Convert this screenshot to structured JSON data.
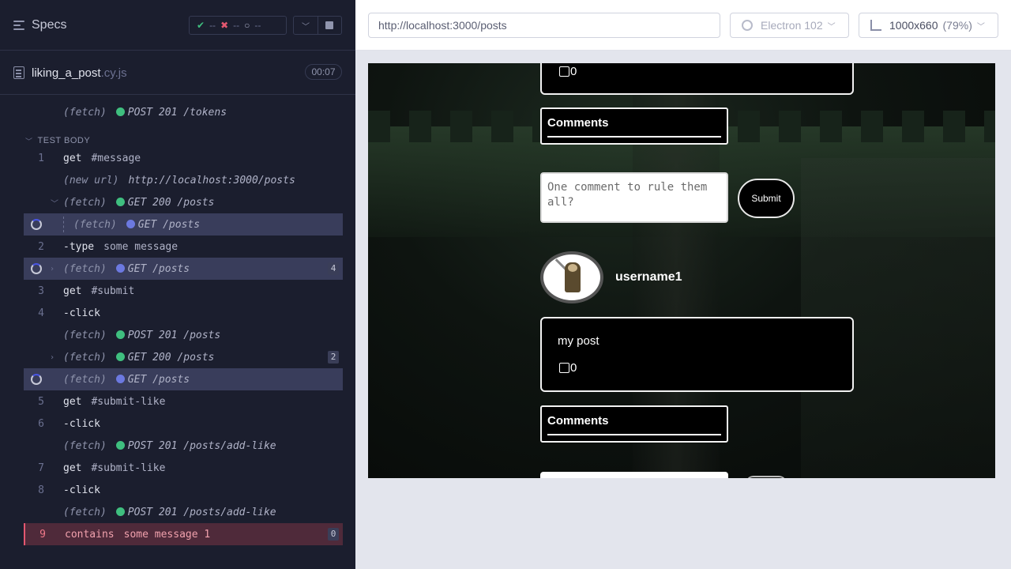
{
  "specs_panel": {
    "title": "Specs",
    "stats": {
      "passed": "--",
      "failed": "--",
      "pending": "--"
    },
    "file": {
      "name": "liking_a_post",
      "ext": ".cy.js",
      "duration": "00:07"
    }
  },
  "reporter": {
    "before_row": {
      "method": "(fetch)",
      "status": "POST 201 /tokens"
    },
    "section_title": "TEST BODY",
    "rows": [
      {
        "num": "1",
        "cmd": "get",
        "msg": "#message"
      },
      {
        "num": "",
        "cmd": "(new url)",
        "msg": "http://localhost:3000/posts"
      },
      {
        "num": "",
        "cmd": "(fetch)",
        "msg": "GET 200 /posts"
      },
      {
        "num": "",
        "cmd": "(fetch)",
        "msg": "GET /posts"
      },
      {
        "num": "2",
        "cmd": "-type",
        "msg": "some message"
      },
      {
        "num": "",
        "cmd": "(fetch)",
        "msg": "GET /posts",
        "badge": "4"
      },
      {
        "num": "3",
        "cmd": "get",
        "msg": "#submit"
      },
      {
        "num": "4",
        "cmd": "-click",
        "msg": ""
      },
      {
        "num": "",
        "cmd": "(fetch)",
        "msg": "POST 201 /posts"
      },
      {
        "num": "",
        "cmd": "(fetch)",
        "msg": "GET 200 /posts",
        "badge": "2"
      },
      {
        "num": "",
        "cmd": "(fetch)",
        "msg": "GET /posts"
      },
      {
        "num": "5",
        "cmd": "get",
        "msg": "#submit-like"
      },
      {
        "num": "6",
        "cmd": "-click",
        "msg": ""
      },
      {
        "num": "",
        "cmd": "(fetch)",
        "msg": "POST 201 /posts/add-like"
      },
      {
        "num": "7",
        "cmd": "get",
        "msg": "#submit-like"
      },
      {
        "num": "8",
        "cmd": "-click",
        "msg": ""
      },
      {
        "num": "",
        "cmd": "(fetch)",
        "msg": "POST 201 /posts/add-like"
      },
      {
        "num": "9",
        "cmd": "contains",
        "msg": "some message 1",
        "badge": "0"
      }
    ]
  },
  "browser_nav": {
    "url": "http://localhost:3000/posts",
    "browser": "Electron 102",
    "viewport": "1000x660",
    "zoom": "(79%)"
  },
  "app": {
    "prev_like_count": "0",
    "comments_title": "Comments",
    "comment_placeholder": "One comment to rule them all?",
    "submit_label": "Submit",
    "username": "username1",
    "post_body": "my post",
    "like_count": "0",
    "comments_title_2": "Comments"
  },
  "colors": {
    "pass": "#3fbf7f",
    "fail": "#e45770",
    "pending": "#6c79e0",
    "accent": "#4956e3"
  }
}
